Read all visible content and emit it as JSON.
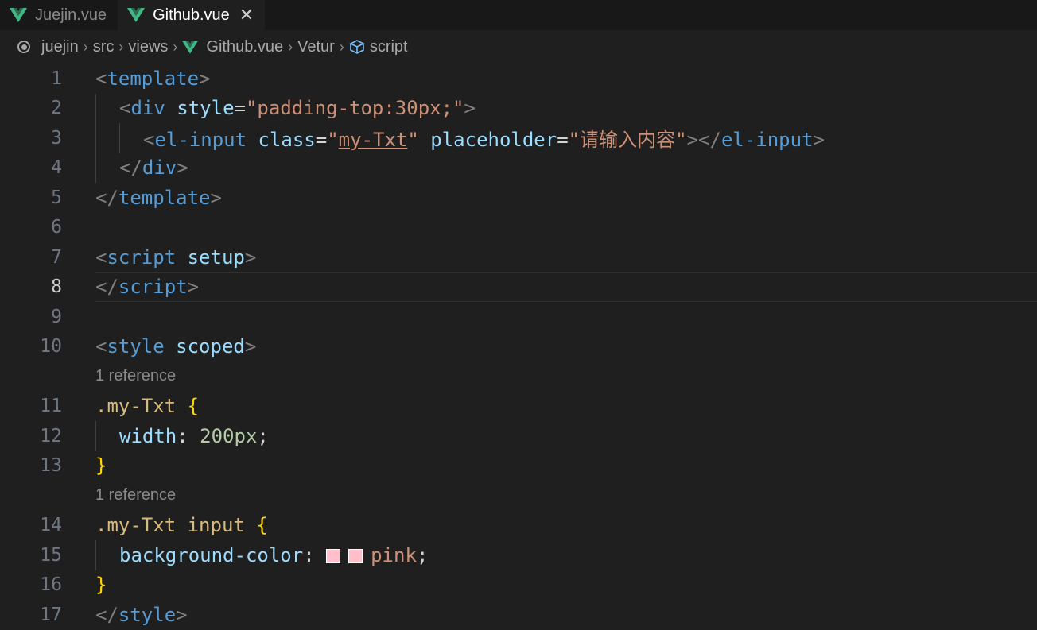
{
  "tabs": [
    {
      "label": "Juejin.vue",
      "active": false
    },
    {
      "label": "Github.vue",
      "active": true
    }
  ],
  "breadcrumb": [
    "juejin",
    "src",
    "views",
    "Github.vue",
    "Vetur",
    "script"
  ],
  "editor": {
    "current_line": 8,
    "code_lens": "1 reference",
    "color_swatch": "#ffc0cb",
    "lines": {
      "l1": {
        "num": "1",
        "t1": "<",
        "t2": "template",
        "t3": ">"
      },
      "l2": {
        "num": "2",
        "t1": "<",
        "t2": "div",
        "t3": "style",
        "t4": "=",
        "t5": "\"padding-top:30px;\"",
        "t6": ">"
      },
      "l3": {
        "num": "3",
        "t1": "<",
        "t2": "el-input",
        "t3": "class",
        "t4": "=",
        "t5": "\"",
        "t6": "my-Txt",
        "t7": "\"",
        "t8": "placeholder",
        "t9": "=",
        "t10": "\"请输入内容\"",
        "t11": "></",
        "t12": "el-input",
        "t13": ">"
      },
      "l4": {
        "num": "4",
        "t1": "</",
        "t2": "div",
        "t3": ">"
      },
      "l5": {
        "num": "5",
        "t1": "</",
        "t2": "template",
        "t3": ">"
      },
      "l6": {
        "num": "6"
      },
      "l7": {
        "num": "7",
        "t1": "<",
        "t2": "script",
        "t3": "setup",
        "t4": ">"
      },
      "l8": {
        "num": "8",
        "t1": "</",
        "t2": "script",
        "t3": ">"
      },
      "l9": {
        "num": "9"
      },
      "l10": {
        "num": "10",
        "t1": "<",
        "t2": "style",
        "t3": "scoped",
        "t4": ">"
      },
      "l11": {
        "num": "11",
        "t1": ".my-Txt",
        "t2": "{"
      },
      "l12": {
        "num": "12",
        "t1": "width",
        "t2": ":",
        "t3": "200px",
        "t4": ";"
      },
      "l13": {
        "num": "13",
        "t1": "}"
      },
      "l14": {
        "num": "14",
        "t1": ".my-Txt input",
        "t2": "{"
      },
      "l15": {
        "num": "15",
        "t1": "background-color",
        "t2": ":",
        "t3": "pink",
        "t4": ";"
      },
      "l16": {
        "num": "16",
        "t1": "}"
      },
      "l17": {
        "num": "17",
        "t1": "</",
        "t2": "style",
        "t3": ">"
      }
    }
  }
}
